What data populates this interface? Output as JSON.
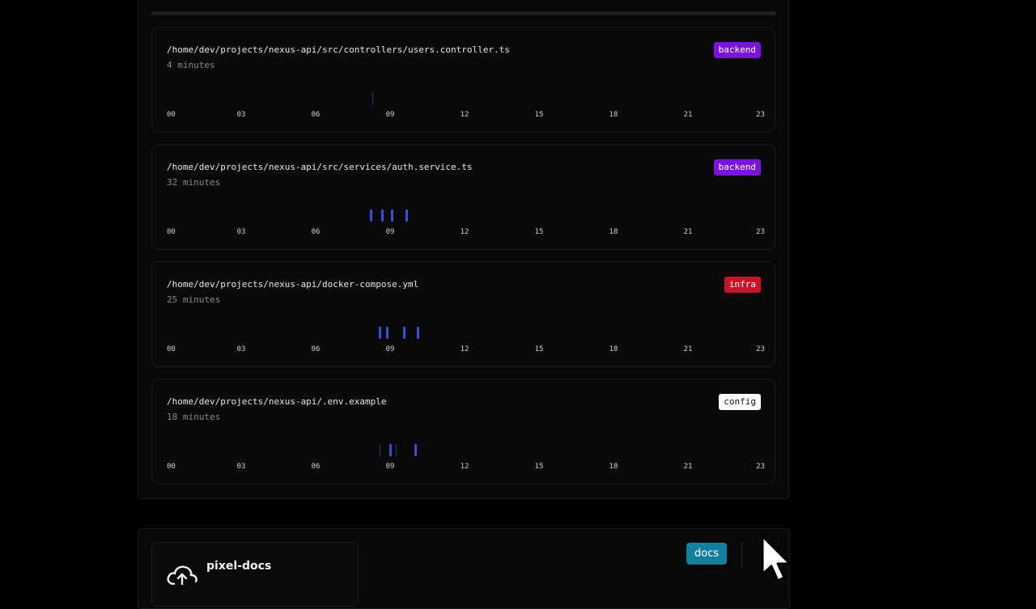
{
  "files": [
    {
      "path": "/home/dev/projects/nexus-api/src/controllers/users.controller.ts",
      "duration": "4 minutes",
      "tag": "backend",
      "tag_color": "#7a14d8",
      "activity_hours": [
        {
          "h": 8.3,
          "w": "thin"
        }
      ]
    },
    {
      "path": "/home/dev/projects/nexus-api/src/services/auth.service.ts",
      "duration": "32 minutes",
      "tag": "backend",
      "tag_color": "#7a14d8",
      "activity_hours": [
        {
          "h": 8.2,
          "w": "bold"
        },
        {
          "h": 8.65,
          "w": "bold"
        },
        {
          "h": 9.05,
          "w": "bold"
        },
        {
          "h": 9.65,
          "w": "bold"
        }
      ]
    },
    {
      "path": "/home/dev/projects/nexus-api/docker-compose.yml",
      "duration": "25 minutes",
      "tag": "infra",
      "tag_color": "#c8142a",
      "activity_hours": [
        {
          "h": 8.55,
          "w": "bold"
        },
        {
          "h": 8.85,
          "w": "bold"
        },
        {
          "h": 9.55,
          "w": "bold"
        },
        {
          "h": 10.1,
          "w": "bold"
        }
      ]
    },
    {
      "path": "/home/dev/projects/nexus-api/.env.example",
      "duration": "18 minutes",
      "tag": "config",
      "tag_color": "#ffffff",
      "activity_hours": [
        {
          "h": 8.6,
          "w": "thin"
        },
        {
          "h": 9.0,
          "w": "bold"
        },
        {
          "h": 9.25,
          "w": "thin"
        },
        {
          "h": 10.0,
          "w": "bold"
        }
      ]
    }
  ],
  "hour_ticks": [
    "00",
    "03",
    "06",
    "09",
    "12",
    "15",
    "18",
    "21",
    "23"
  ],
  "project": {
    "name": "pixel-docs",
    "badge": "docs",
    "icon": "cloud-upload-icon"
  },
  "accent_bar_color": "#3c4fd9"
}
